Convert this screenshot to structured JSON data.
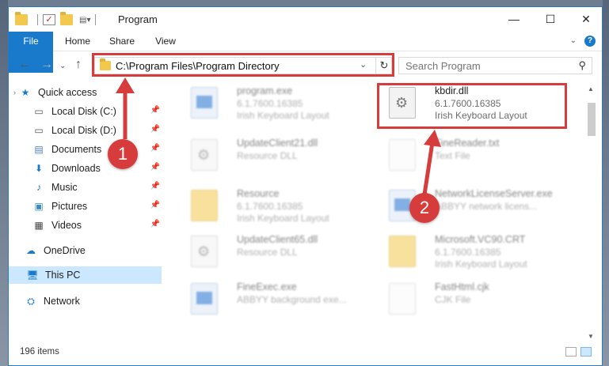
{
  "window": {
    "title": "Program"
  },
  "ribbon": {
    "tabs": [
      "File",
      "Home",
      "Share",
      "View"
    ],
    "help": "?"
  },
  "address": {
    "path": "C:\\Program Files\\Program Directory",
    "refresh": "↻"
  },
  "search": {
    "placeholder": "Search Program"
  },
  "sidebar": {
    "items": [
      {
        "label": "Quick access",
        "icon": "star-icon"
      },
      {
        "label": "Local Disk (C:)",
        "icon": "drive-icon"
      },
      {
        "label": "Local Disk (D:)",
        "icon": "drive-icon"
      },
      {
        "label": "Documents",
        "icon": "documents-icon"
      },
      {
        "label": "Downloads",
        "icon": "download-icon"
      },
      {
        "label": "Music",
        "icon": "music-icon"
      },
      {
        "label": "Pictures",
        "icon": "pictures-icon"
      },
      {
        "label": "Videos",
        "icon": "videos-icon"
      },
      {
        "label": "OneDrive",
        "icon": "cloud-icon"
      },
      {
        "label": "This PC",
        "icon": "computer-icon"
      },
      {
        "label": "Network",
        "icon": "network-icon"
      }
    ]
  },
  "files": [
    {
      "name": "program.exe",
      "line1": "6.1.7600.16385",
      "line2": "Irish Keyboard Layout",
      "type": "exe"
    },
    {
      "name": "kbdir.dll",
      "line1": "6.1.7600.16385",
      "line2": "Irish Keyboard Layout",
      "type": "dll"
    },
    {
      "name": "UpdateClient21.dll",
      "line1": "Resource DLL",
      "line2": "",
      "type": "dll"
    },
    {
      "name": "FineReader.txt",
      "line1": "Text File",
      "line2": "",
      "type": "txt"
    },
    {
      "name": "Resource",
      "line1": "6.1.7600.16385",
      "line2": "Irish Keyboard Layout",
      "type": "folder"
    },
    {
      "name": "NetworkLicenseServer.exe",
      "line1": "ABBYY network licens...",
      "line2": "",
      "type": "exe"
    },
    {
      "name": "UpdateClient65.dll",
      "line1": "Resource DLL",
      "line2": "",
      "type": "dll"
    },
    {
      "name": "Microsoft.VC90.CRT",
      "line1": "6.1.7600.16385",
      "line2": "Irish Keyboard Layout",
      "type": "folder"
    },
    {
      "name": "FineExec.exe",
      "line1": "ABBYY background exe...",
      "line2": "",
      "type": "exe"
    },
    {
      "name": "FastHtml.cjk",
      "line1": "CJK File",
      "line2": "",
      "type": "txt"
    }
  ],
  "status": {
    "count": "196 items"
  },
  "annotations": {
    "step1": "1",
    "step2": "2",
    "color": "#d73c3c"
  }
}
